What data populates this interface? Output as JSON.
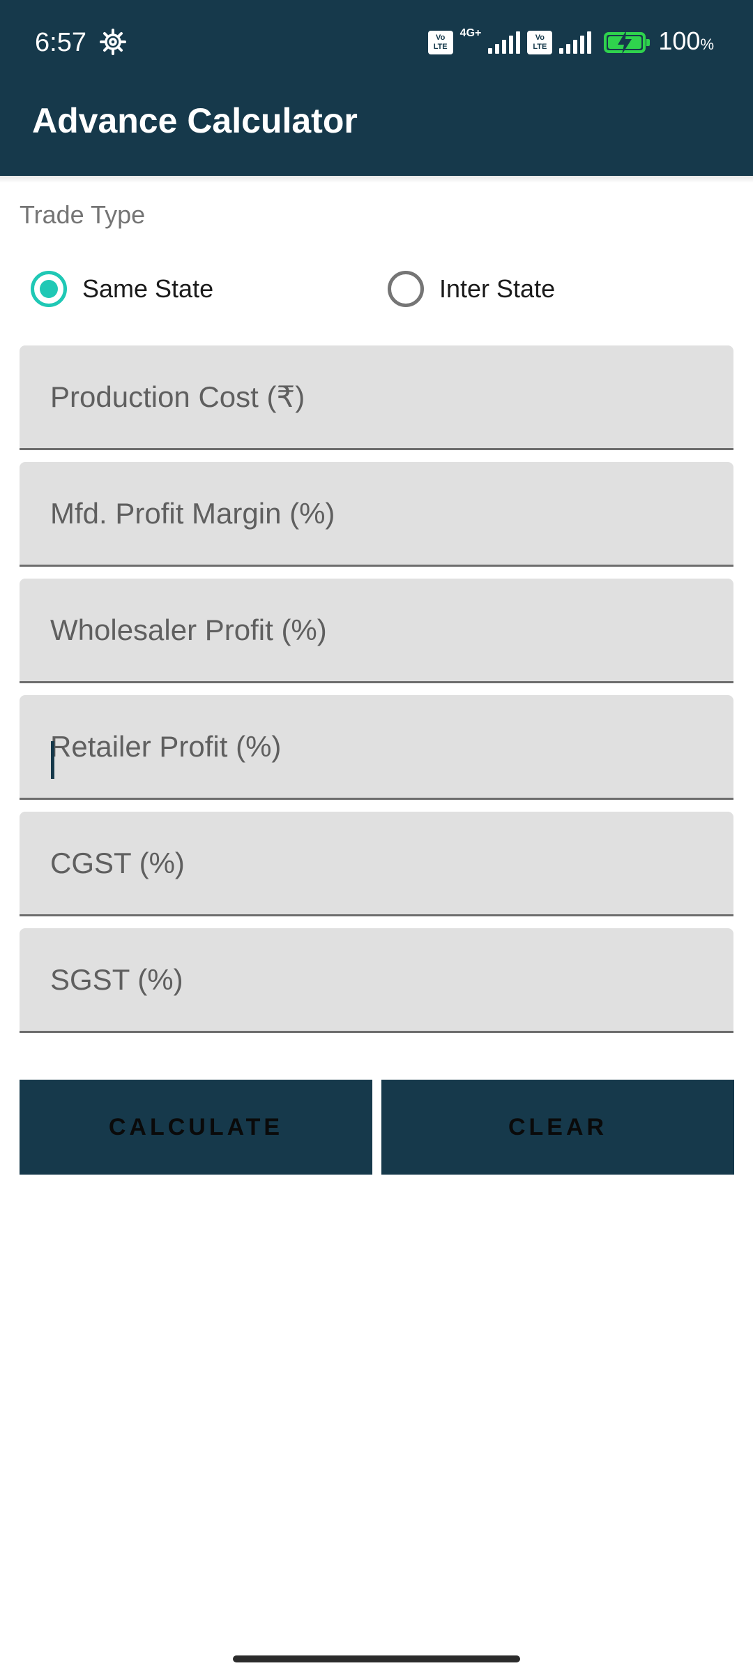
{
  "status_bar": {
    "time": "6:57",
    "network_type": "4G+",
    "volte_line1": "Vo",
    "volte_line2": "LTE",
    "battery_percent": "100",
    "battery_unit": "%"
  },
  "app_bar": {
    "title": "Advance Calculator"
  },
  "trade_type": {
    "label": "Trade Type",
    "options": [
      {
        "label": "Same State",
        "selected": true
      },
      {
        "label": "Inter State",
        "selected": false
      }
    ]
  },
  "fields": [
    {
      "placeholder": "Production Cost (₹)",
      "value": ""
    },
    {
      "placeholder": "Mfd. Profit Margin (%)",
      "value": ""
    },
    {
      "placeholder": "Wholesaler Profit (%)",
      "value": ""
    },
    {
      "placeholder": "Retailer Profit (%)",
      "value": "",
      "focused": true
    },
    {
      "placeholder": "CGST (%)",
      "value": ""
    },
    {
      "placeholder": "SGST (%)",
      "value": ""
    }
  ],
  "buttons": {
    "calculate": "CALCULATE",
    "clear": "CLEAR"
  },
  "colors": {
    "primary": "#16394b",
    "accent": "#1fc8b5",
    "field_background": "#e0e0e0",
    "battery": "#2fd34d"
  },
  "icons": {
    "status_settings": "gear-icon",
    "signal": "signal-icon",
    "battery": "battery-charging-icon"
  }
}
